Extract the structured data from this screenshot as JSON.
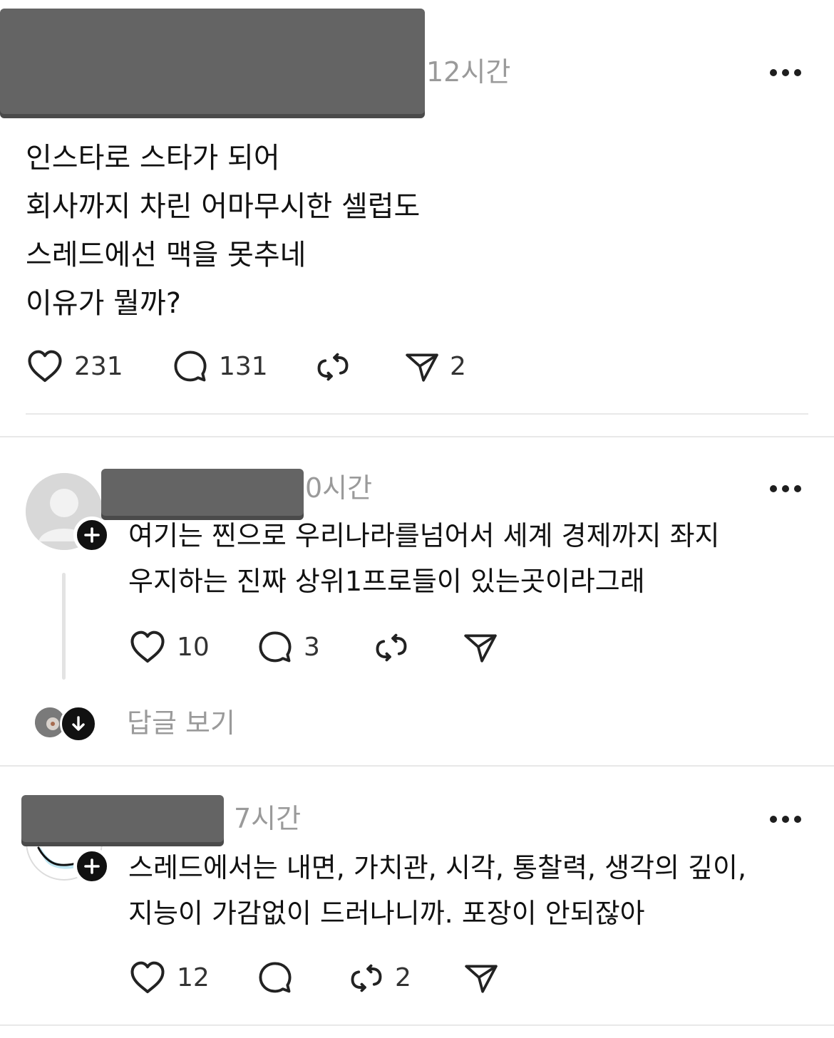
{
  "post": {
    "time": "12시간",
    "lines": [
      "인스타로 스타가 되어",
      "회사까지 차린 어마무시한 셀럽도",
      "스레드에선 맥을 못추네",
      "이유가 뭘까?"
    ],
    "likes": "231",
    "comments": "131",
    "shares": "2"
  },
  "replies": [
    {
      "time": "0시간",
      "lines": [
        "여기는 찐으로 우리나라를넘어서 세계 경제까지 좌지",
        "우지하는 진짜 상위1프로들이 있는곳이라그래"
      ],
      "likes": "10",
      "comments": "3",
      "view_replies": "답글 보기"
    },
    {
      "time": "7시간",
      "lines": [
        "스레드에서는 내면, 가치관, 시각, 통찰력, 생각의 깊이,",
        "지능이 가감없이 드러나니까. 포장이 안되잖아"
      ],
      "likes": "12",
      "reposts": "2"
    }
  ],
  "icons": [
    "heart-icon",
    "comment-icon",
    "repost-icon",
    "send-icon",
    "more-icon",
    "follow-plus-icon",
    "arrow-down-icon"
  ],
  "colors": {
    "text": "#111111",
    "muted": "#9a9a9a",
    "divider": "#e8e8e8",
    "redaction": "#646464"
  }
}
